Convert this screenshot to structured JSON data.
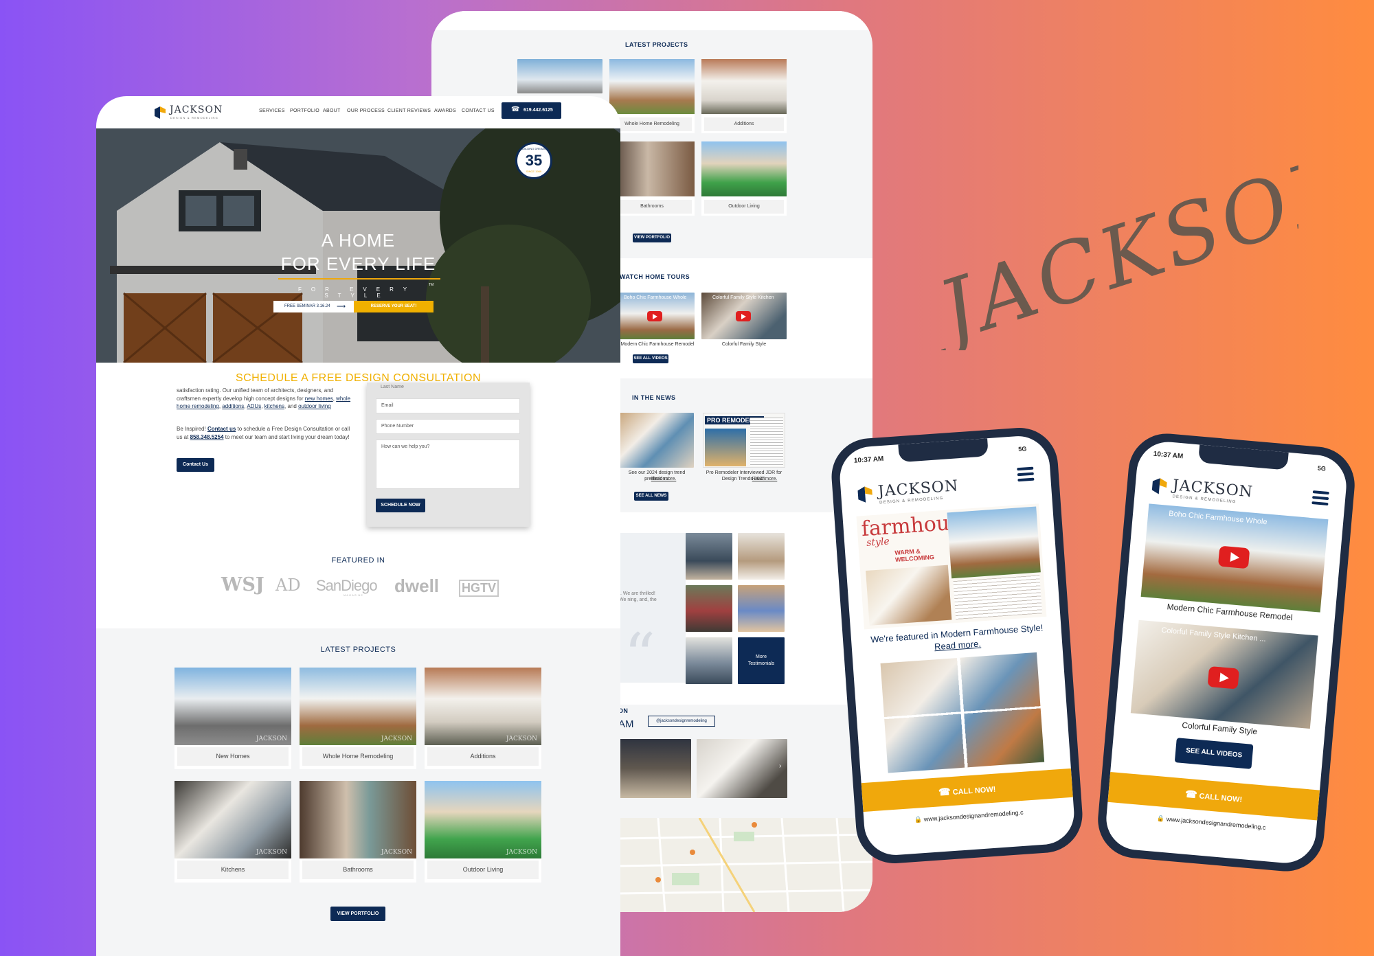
{
  "brand": {
    "script_title": "JACKSON",
    "logo_name": "JACKSON",
    "logo_sub": "DESIGN & REMODELING",
    "colors": {
      "navy": "#0d2a55",
      "gold": "#f0a80c",
      "heading_gold": "#f0b000"
    }
  },
  "back_panel": {
    "latest_projects_title": "LATEST PROJECTS",
    "projects": [
      "Whole Home Remodeling",
      "Additions",
      "Bathrooms",
      "Outdoor Living"
    ],
    "view_portfolio": "VIEW PORTFOLIO",
    "watch_title": "WATCH HOME TOURS",
    "videos": [
      {
        "overlay": "Boho Chic Farmhouse Whole",
        "caption": "Modern Chic Farmhouse Remodel"
      },
      {
        "overlay": "Colorful Family Style Kitchen",
        "caption": "Colorful Family Style"
      }
    ],
    "see_all_videos": "SEE ALL VIDEOS",
    "news_title": "IN THE NEWS",
    "news": [
      {
        "text": "See our 2024 design trend predictions!",
        "link": "Read more."
      },
      {
        "text": "Pro Remodeler Interviewed JDR for Design Trends 2024.",
        "link": "Read more."
      }
    ],
    "see_all_news": "SEE ALL NEWS",
    "news_mag_label": "PRO REMODELER",
    "testimonial_snippet": "t. We are thrilled! We ning, and, the",
    "more_testimonials": "More Testimonials",
    "social_title_1": "ON",
    "social_title_2": "AM",
    "social_handle": "@jacksondesignremodeling"
  },
  "front": {
    "nav": [
      "SERVICES",
      "PORTFOLIO",
      "ABOUT",
      "OUR PROCESS",
      "CLIENT REVIEWS",
      "AWARDS",
      "CONTACT US"
    ],
    "phone": "619.442.6125",
    "badge": {
      "number": "35",
      "since": "SINCE 1989",
      "ring": "BUILDING DREAMS"
    },
    "hero_line1": "A HOME",
    "hero_line2": "FOR EVERY LIFE",
    "hero_tagline": "FOR EVERY STYLE",
    "tm": "TM",
    "seminar": "FREE SEMINAR 3.16.24",
    "seminar_arrow": "⟶",
    "reserve": "RESERVE YOUR SEAT!",
    "consult_title": "SCHEDULE A FREE DESIGN CONSULTATION",
    "intro_1": "satisfaction rating. Our unified team of architects, designers, and craftsmen expertly develop high concept designs for",
    "intro_links": [
      "new homes",
      "whole home remodeling",
      "additions",
      "ADUs",
      "kitchens"
    ],
    "intro_and": "and",
    "intro_last": "outdoor living",
    "inspired_a": "Be Inspired!",
    "inspired_link": "Contact us",
    "inspired_b": "to schedule a Free Design Consultation or call us at",
    "inspired_phone": "858.348.5254",
    "inspired_c": "to meet our team and start living your dream today!",
    "contact_btn": "Contact Us",
    "form": {
      "last_name": "Last Name",
      "email": "Email",
      "phone": "Phone Number",
      "message": "How can we help you?",
      "submit": "SCHEDULE NOW"
    },
    "featured_title": "FEATURED IN",
    "featured_logos": [
      "WSJ",
      "AD",
      "SanDiego",
      "dwell",
      "HGTV"
    ],
    "featured_sub": "MAGAZINE",
    "latest_title": "LATEST PROJECTS",
    "projects": [
      "New Homes",
      "Whole Home Remodeling",
      "Additions",
      "Kitchens",
      "Bathrooms",
      "Outdoor Living"
    ],
    "watermark": "JACKSON",
    "view_portfolio": "VIEW PORTFOLIO"
  },
  "phone1": {
    "time": "10:37 AM",
    "signal": "5G",
    "mag_title": "farmhouse",
    "mag_style": "style",
    "mag_tag": "WARM & WELCOMING",
    "featured_text": "We're featured in Modern Farmhouse Style!",
    "featured_link": "Read more.",
    "call": "CALL NOW!",
    "url": "www.jacksondesignandremodeling.c"
  },
  "phone2": {
    "time": "10:37 AM",
    "signal": "5G",
    "video1_overlay": "Boho Chic Farmhouse Whole",
    "video1_caption": "Modern Chic Farmhouse Remodel",
    "video2_overlay": "Colorful Family Style Kitchen ...",
    "video2_caption": "Colorful Family Style",
    "see_all": "SEE ALL VIDEOS",
    "call": "CALL NOW!",
    "url": "www.jacksondesignandremodeling.c"
  }
}
